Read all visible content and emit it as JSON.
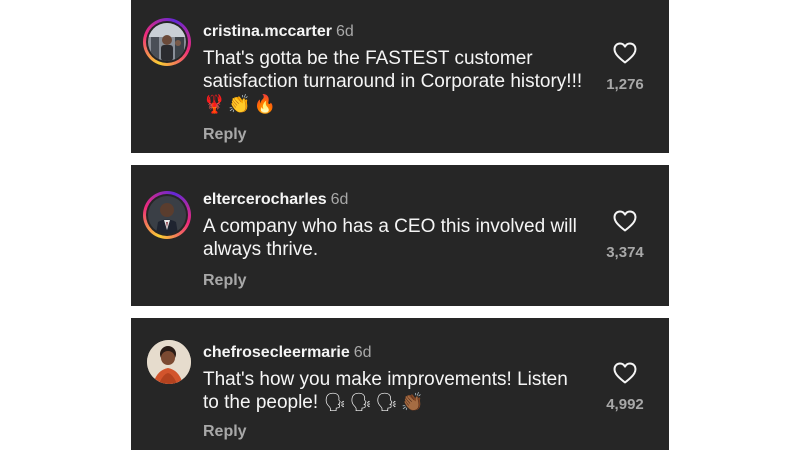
{
  "comments": [
    {
      "username": "cristina.mccarter",
      "time": "6d",
      "text": "That's gotta be the FASTEST customer satisfaction turnaround in Corporate history!!!",
      "emojis": "🦞👏🔥",
      "reply_label": "Reply",
      "likes": "1,276"
    },
    {
      "username": "eltercerocharles",
      "time": "6d",
      "text": "A company who has a CEO this involved will always thrive.",
      "emojis": "",
      "reply_label": "Reply",
      "likes": "3,374"
    },
    {
      "username": "chefrosecleermarie",
      "time": "6d",
      "text": "That's how you make improvements! Listen to the people!",
      "emojis": "🗣🗣🗣👏🏾",
      "reply_label": "Reply",
      "likes": "4,992"
    }
  ],
  "icons": {
    "like": "heart-outline-icon"
  },
  "colors": {
    "card_bg": "#262626",
    "text": "#f5f5f5",
    "muted": "#a8a8a8"
  }
}
